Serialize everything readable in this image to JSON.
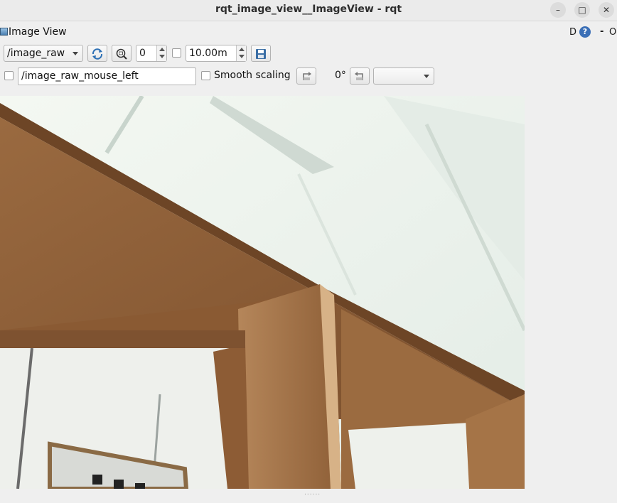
{
  "window": {
    "title": "rqt_image_view__ImageView - rqt",
    "minimize_glyph": "–",
    "maximize_glyph": "□",
    "close_glyph": "✕"
  },
  "plugin": {
    "title": "Image View",
    "header_d": "D",
    "help_glyph": "?",
    "header_dash": "-",
    "header_o": "O"
  },
  "toolbar": {
    "topic": "/image_raw",
    "zoom_value": "0",
    "interval_value": "10.00m",
    "mouse_topic": "/image_raw_mouse_left",
    "smooth_scaling_label": "Smooth scaling",
    "rotation_label": "0°",
    "rotation_select": ""
  },
  "icons": {
    "refresh": "refresh-icon",
    "zoom": "zoom-fit-icon",
    "save": "save-icon",
    "rotate_left": "rotate-left-icon",
    "rotate_right": "rotate-right-icon",
    "help": "help-icon"
  },
  "colors": {
    "window_bg": "#efefef",
    "wood": "#8a5a33",
    "wall": "#eef4ef"
  }
}
